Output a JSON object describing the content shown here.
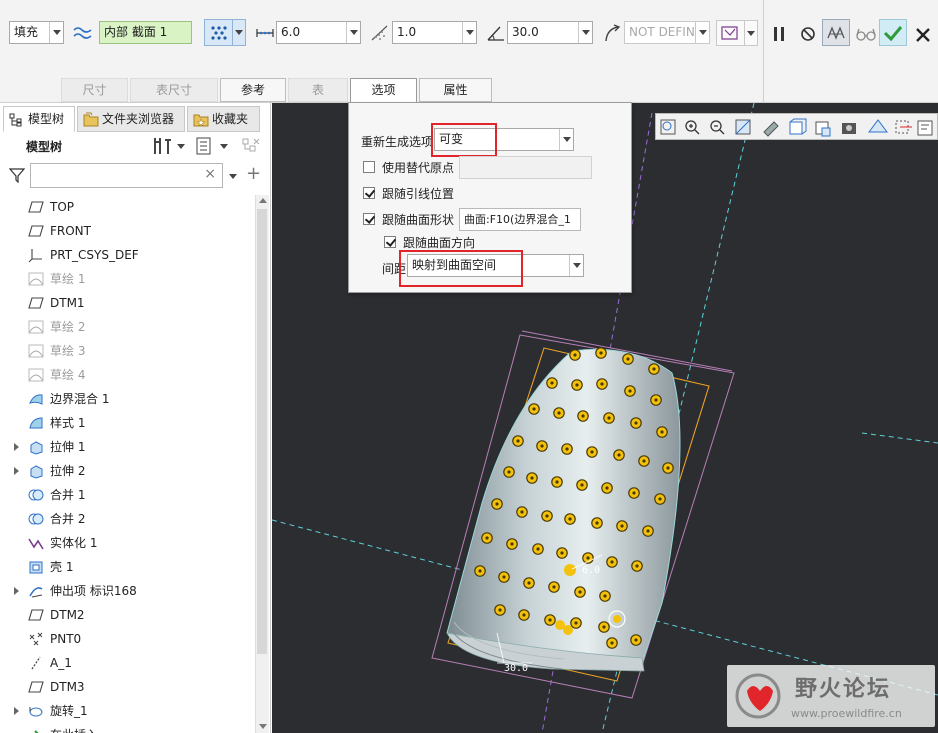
{
  "ribbon": {
    "fill_label": "填充",
    "section_label": "内部 截面 1",
    "value1": "6.0",
    "value2": "1.0",
    "value3": "30.0",
    "value4": "NOT DEFIN"
  },
  "tabs": [
    "尺寸",
    "表尺寸",
    "参考",
    "表",
    "选项",
    "属性"
  ],
  "left_panel": {
    "tabs": [
      "模型树",
      "文件夹浏览器",
      "收藏夹"
    ],
    "title": "模型树",
    "search_placeholder": ""
  },
  "tree": [
    {
      "label": "TOP",
      "icon": "datum-plane-icon",
      "dim": false,
      "expand": false
    },
    {
      "label": "FRONT",
      "icon": "datum-plane-icon",
      "dim": false,
      "expand": false
    },
    {
      "label": "PRT_CSYS_DEF",
      "icon": "csys-icon",
      "dim": false,
      "expand": false
    },
    {
      "label": "草绘 1",
      "icon": "sketch-icon",
      "dim": true,
      "expand": false
    },
    {
      "label": "DTM1",
      "icon": "datum-plane-icon",
      "dim": false,
      "expand": false
    },
    {
      "label": "草绘 2",
      "icon": "sketch-icon",
      "dim": true,
      "expand": false
    },
    {
      "label": "草绘 3",
      "icon": "sketch-icon",
      "dim": true,
      "expand": false
    },
    {
      "label": "草绘 4",
      "icon": "sketch-icon",
      "dim": true,
      "expand": false
    },
    {
      "label": "边界混合 1",
      "icon": "boundary-blend-icon",
      "dim": false,
      "expand": false
    },
    {
      "label": "样式 1",
      "icon": "style-icon",
      "dim": false,
      "expand": false
    },
    {
      "label": "拉伸 1",
      "icon": "extrude-icon",
      "dim": false,
      "expand": true
    },
    {
      "label": "拉伸 2",
      "icon": "extrude-icon",
      "dim": false,
      "expand": true
    },
    {
      "label": "合并 1",
      "icon": "merge-icon",
      "dim": false,
      "expand": false
    },
    {
      "label": "合并 2",
      "icon": "merge-icon",
      "dim": false,
      "expand": false
    },
    {
      "label": "实体化 1",
      "icon": "solidify-icon",
      "dim": false,
      "expand": false
    },
    {
      "label": "壳 1",
      "icon": "shell-icon",
      "dim": false,
      "expand": false
    },
    {
      "label": "伸出项 标识168",
      "icon": "protrusion-icon",
      "dim": false,
      "expand": true
    },
    {
      "label": "DTM2",
      "icon": "datum-plane-icon",
      "dim": false,
      "expand": false
    },
    {
      "label": "PNT0",
      "icon": "datum-point-icon",
      "dim": false,
      "expand": false
    },
    {
      "label": "A_1",
      "icon": "datum-axis-icon",
      "dim": false,
      "expand": false
    },
    {
      "label": "DTM3",
      "icon": "datum-plane-icon",
      "dim": false,
      "expand": false
    },
    {
      "label": "旋转_1",
      "icon": "revolve-icon",
      "dim": false,
      "expand": true
    },
    {
      "label": "在此插入",
      "icon": "insert-here-icon",
      "dim": false,
      "expand": false
    }
  ],
  "popup": {
    "regen_label": "重新生成选项",
    "regen_value": "可变",
    "alt_origin_label": "使用替代原点",
    "follow_leader_label": "跟随引线位置",
    "follow_surface_label": "跟随曲面形状",
    "surface_value": "曲面:F10(边界混合_1",
    "follow_direction_label": "跟随曲面方向",
    "spacing_label": "间距",
    "spacing_value": "映射到曲面空间"
  },
  "viewport": {
    "dim_6": "6.0",
    "dim_30": "30.0"
  },
  "watermark": {
    "title": "野火论坛",
    "url": "www.proewildfire.cn"
  },
  "colors": {
    "viewport_bg": "#2b2d31",
    "part_fill": "#a9b6b9",
    "hole_yellow": "#f4c20d",
    "highlight_red": "#e0262a",
    "confirm_green": "#2e9a3a"
  }
}
